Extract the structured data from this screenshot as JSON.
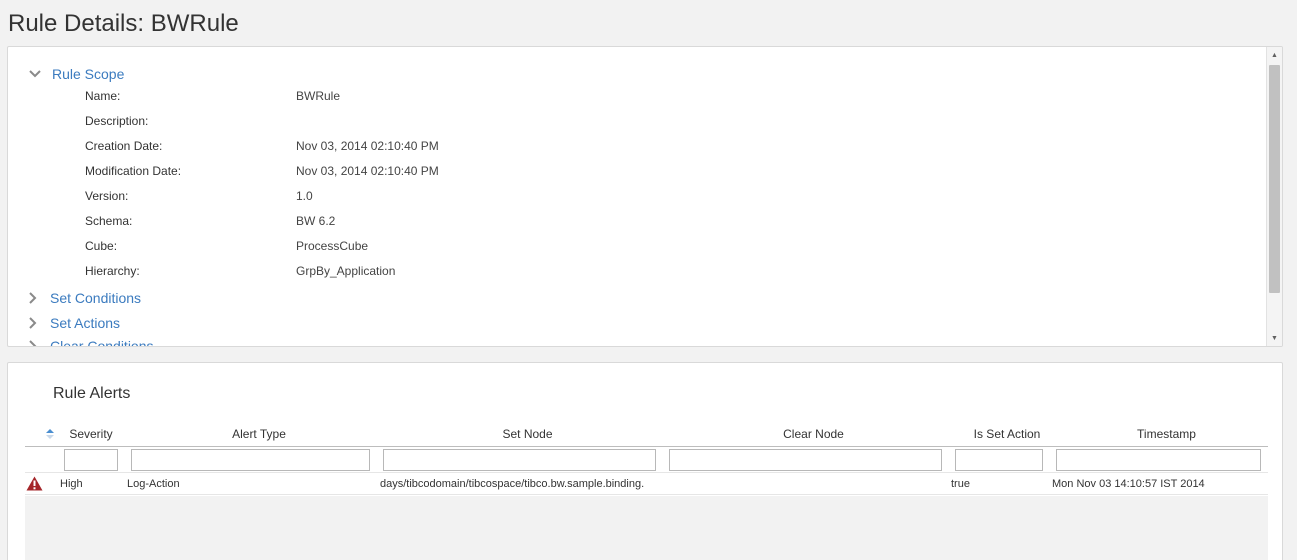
{
  "page": {
    "title": "Rule Details: BWRule"
  },
  "scope": {
    "section_title": "Rule Scope",
    "fields": [
      {
        "label": "Name:",
        "value": "BWRule"
      },
      {
        "label": "Description:",
        "value": ""
      },
      {
        "label": "Creation Date:",
        "value": "Nov 03, 2014 02:10:40 PM"
      },
      {
        "label": "Modification Date:",
        "value": "Nov 03, 2014 02:10:40 PM"
      },
      {
        "label": "Version:",
        "value": "1.0"
      },
      {
        "label": "Schema:",
        "value": "BW 6.2"
      },
      {
        "label": "Cube:",
        "value": "ProcessCube"
      },
      {
        "label": "Hierarchy:",
        "value": "GrpBy_Application"
      }
    ],
    "collapsed_sections": [
      "Set Conditions",
      "Set Actions",
      "Clear Conditions"
    ]
  },
  "alerts": {
    "title": "Rule Alerts",
    "columns": [
      "Severity",
      "Alert Type",
      "Set Node",
      "Clear Node",
      "Is Set Action",
      "Timestamp"
    ],
    "rows": [
      {
        "severity": "High",
        "alert_type": "Log-Action",
        "set_node": "days/tibcodomain/tibcospace/tibco.bw.sample.binding.",
        "clear_node": "",
        "is_set_action": "true",
        "timestamp": "Mon Nov 03 14:10:57 IST 2014"
      }
    ]
  },
  "icons": {
    "expanded_chevron": "chevron-down-icon",
    "collapsed_chevron": "chevron-right-icon",
    "sort": "sort-asc-icon",
    "severity": "warning-triangle-icon"
  },
  "colors": {
    "link": "#3b7bbf",
    "warning": "#a5262a"
  }
}
